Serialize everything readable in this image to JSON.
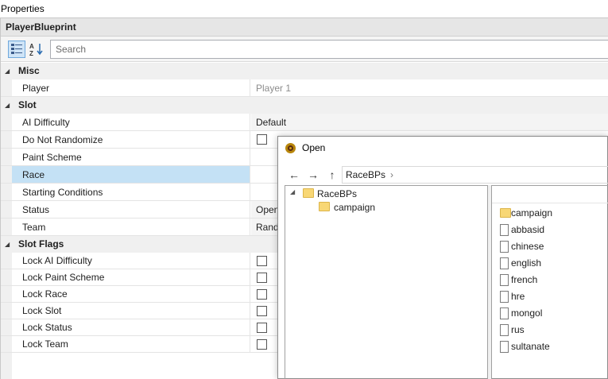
{
  "window": {
    "title": "Properties"
  },
  "blueprint": {
    "title": "PlayerBlueprint"
  },
  "toolbar": {
    "search_placeholder": "Search"
  },
  "categories": {
    "misc": "Misc",
    "slot": "Slot",
    "slot_flags": "Slot Flags"
  },
  "props": {
    "player": {
      "label": "Player",
      "value": "Player 1"
    },
    "ai_difficulty": {
      "label": "AI Difficulty",
      "value": "Default"
    },
    "do_not_randomize": {
      "label": "Do Not Randomize"
    },
    "paint_scheme": {
      "label": "Paint Scheme"
    },
    "race": {
      "label": "Race"
    },
    "starting_conditions": {
      "label": "Starting Conditions"
    },
    "status": {
      "label": "Status",
      "value": "Open"
    },
    "team": {
      "label": "Team",
      "value": "Rand"
    },
    "lock_ai_difficulty": {
      "label": "Lock AI Difficulty"
    },
    "lock_paint_scheme": {
      "label": "Lock Paint Scheme"
    },
    "lock_race": {
      "label": "Lock Race"
    },
    "lock_slot": {
      "label": "Lock Slot"
    },
    "lock_status": {
      "label": "Lock Status"
    },
    "lock_team": {
      "label": "Lock Team"
    }
  },
  "dialog": {
    "title": "Open",
    "nav": {
      "back": "←",
      "forward": "→",
      "up": "↑"
    },
    "address": {
      "path": "RaceBPs",
      "separator": "›"
    },
    "tree": {
      "root": "RaceBPs",
      "child": "campaign"
    },
    "files": [
      "campaign",
      "abbasid",
      "chinese",
      "english",
      "french",
      "hre",
      "mongol",
      "rus",
      "sultanate"
    ]
  },
  "colors": {
    "selected_row": "#c4e1f5",
    "folder": "#f8d775",
    "category_bg": "#f0f0f0"
  }
}
